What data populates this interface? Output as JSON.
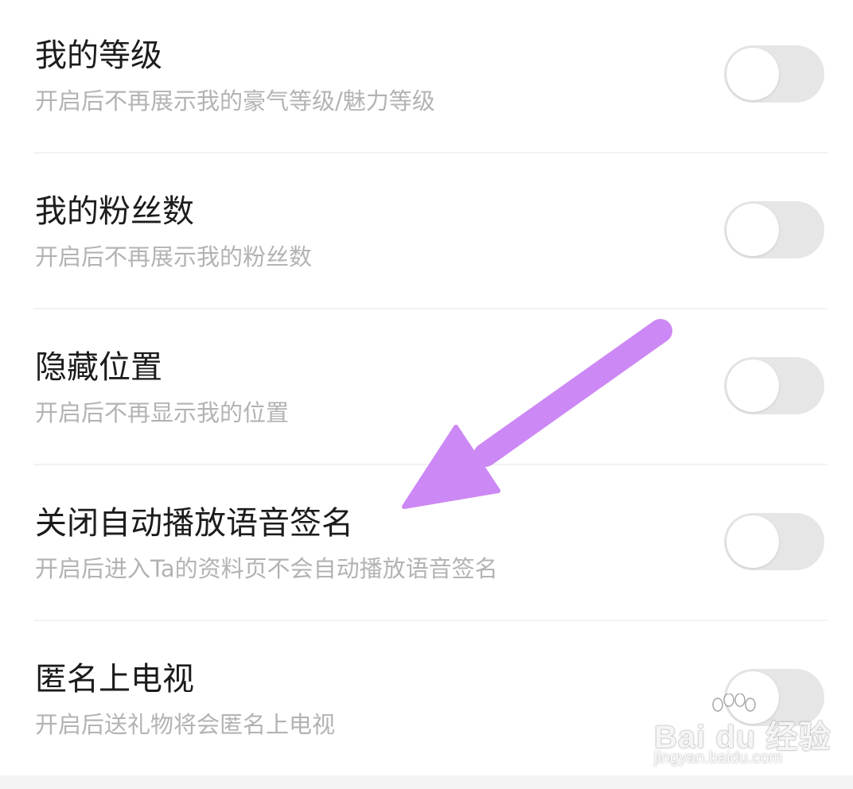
{
  "colors": {
    "title": "#1c1c1c",
    "description": "#b3b3b3",
    "divider": "#f2f2f2",
    "toggle_off_track": "#e6e6e6",
    "toggle_knob": "#ffffff",
    "annotation_arrow": "#cc88f4"
  },
  "settings": [
    {
      "title": "我的等级",
      "description": "开启后不再展示我的豪气等级/魅力等级",
      "enabled": false
    },
    {
      "title": "我的粉丝数",
      "description": "开启后不再展示我的粉丝数",
      "enabled": false
    },
    {
      "title": "隐藏位置",
      "description": "开启后不再显示我的位置",
      "enabled": false
    },
    {
      "title": "关闭自动播放语音签名",
      "description": "开启后进入Ta的资料页不会自动播放语音签名",
      "enabled": false
    },
    {
      "title": "匿名上电视",
      "description": "开启后送礼物将会匿名上电视",
      "enabled": false
    }
  ],
  "annotation": {
    "icon": "arrow-icon"
  },
  "watermark": {
    "brand": "Bai du 经验",
    "url": "jingyan.baidu.com"
  }
}
